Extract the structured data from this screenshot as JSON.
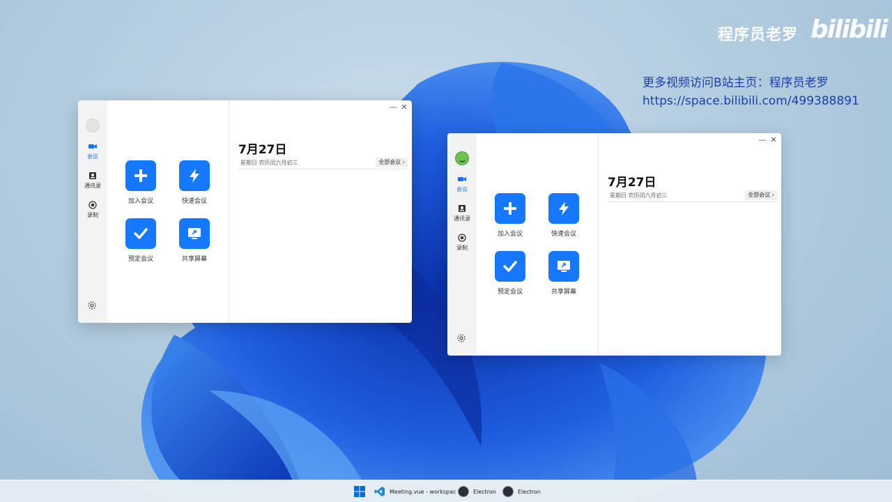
{
  "watermark": {
    "author": "程序员老罗",
    "logo_text": "bilibili",
    "promo_line1": "更多视频访问B站主页：程序员老罗",
    "promo_line2": "https://space.bilibili.com/499388891"
  },
  "windows": [
    {
      "rail": {
        "meeting": "会议",
        "contacts": "通讯录",
        "record": "录制"
      },
      "actions": {
        "join": "加入会议",
        "quick": "快速会议",
        "schedule": "预定会议",
        "share": "共享屏幕"
      },
      "main": {
        "date": "7月27日",
        "lunar": "星期日 农历闰六月初三",
        "all_meetings": "全部会议"
      },
      "controls": {
        "minimize": "—",
        "close": "✕"
      }
    },
    {
      "rail": {
        "meeting": "会议",
        "contacts": "通讯录",
        "record": "录制"
      },
      "actions": {
        "join": "加入会议",
        "quick": "快速会议",
        "schedule": "预定会议",
        "share": "共享屏幕"
      },
      "main": {
        "date": "7月27日",
        "lunar": "星期日 农历闰六月初三",
        "all_meetings": "全部会议"
      },
      "controls": {
        "minimize": "—",
        "close": "✕"
      }
    }
  ],
  "taskbar": {
    "items": [
      {
        "icon": "windows-start-icon",
        "label": ""
      },
      {
        "icon": "vscode-icon",
        "label": "Meeting.vue - workspac"
      },
      {
        "icon": "electron-icon",
        "label": "Electron"
      },
      {
        "icon": "electron-icon",
        "label": "Electron"
      }
    ]
  },
  "colors": {
    "accent": "#1677ff",
    "promo": "#1b3fa8"
  }
}
